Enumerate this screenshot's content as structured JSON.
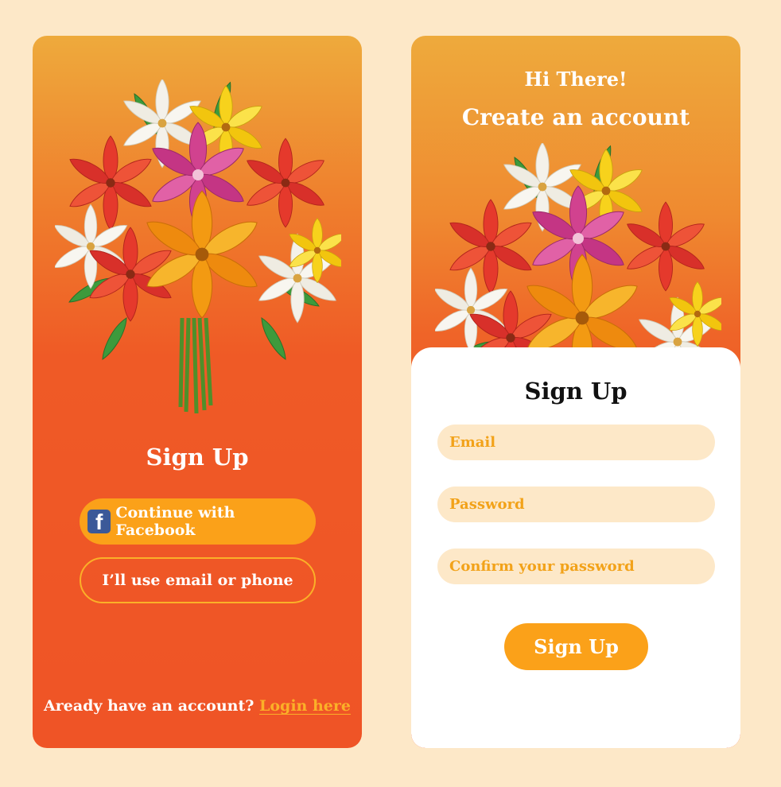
{
  "left_screen": {
    "title": "Sign Up",
    "facebook_button": "Continue with Facebook",
    "facebook_icon_glyph": "f",
    "email_phone_button": "I’ll use email or phone",
    "footer_text": "Aready have an account? ",
    "login_link": "Login here "
  },
  "right_screen": {
    "greeting": "Hi There!",
    "subtitle": "Create an account",
    "form_title": "Sign Up",
    "email_placeholder": "Email",
    "password_placeholder": "Password",
    "confirm_placeholder": "Confirm your password",
    "submit_button": "Sign Up"
  },
  "colors": {
    "page_background": "#fde8c8",
    "accent_orange": "#fba119",
    "gradient_top": "#eeaa3c",
    "gradient_bottom": "#ef5426",
    "input_background": "#fde8c8",
    "input_text": "#f2a219",
    "facebook_blue": "#3b5998"
  },
  "icons": [
    "bouquet-illustration",
    "facebook-icon"
  ]
}
